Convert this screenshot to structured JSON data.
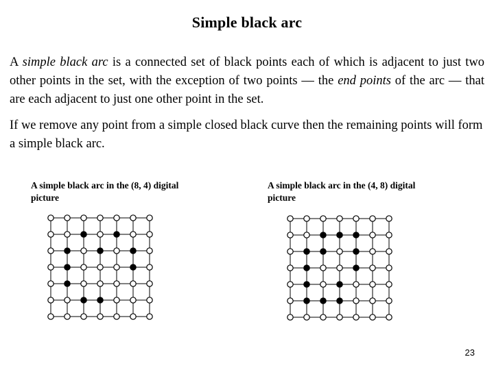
{
  "slide": {
    "title": "Simple black arc",
    "page_number": "23",
    "background_color": "#ffffff",
    "text_color": "#000000"
  },
  "body": {
    "paragraph1": {
      "segment_1": "A ",
      "emphasis_1": "simple black arc",
      "segment_2": " is a connected set of black points each of which is adjacent to just two other points in the set, with the exception of two points — the ",
      "emphasis_2": "end points",
      "segment_3": " of the arc — that are each adjacent to just one other point in the set."
    },
    "paragraph2": "If we remove any point from a simple closed black curve then the remaining points will form a simple black arc."
  },
  "figures": [
    {
      "caption": "A simple black arc in the (8, 4) digital picture",
      "adjacency": "(8, 4)",
      "grid": {
        "rows": 7,
        "cols": 7,
        "spacing": 24,
        "node_radius": 4.2,
        "black_nodes": [
          [
            1,
            2
          ],
          [
            1,
            4
          ],
          [
            2,
            1
          ],
          [
            2,
            3
          ],
          [
            2,
            5
          ],
          [
            3,
            1
          ],
          [
            3,
            5
          ],
          [
            4,
            1
          ],
          [
            5,
            2
          ],
          [
            5,
            3
          ]
        ]
      }
    },
    {
      "caption": "A simple black arc in the (4, 8) digital picture",
      "adjacency": "(4, 8)",
      "grid": {
        "rows": 7,
        "cols": 7,
        "spacing": 24,
        "node_radius": 4.2,
        "black_nodes": [
          [
            1,
            2
          ],
          [
            1,
            3
          ],
          [
            1,
            4
          ],
          [
            2,
            1
          ],
          [
            2,
            2
          ],
          [
            2,
            4
          ],
          [
            3,
            1
          ],
          [
            3,
            4
          ],
          [
            4,
            1
          ],
          [
            4,
            3
          ],
          [
            5,
            1
          ],
          [
            5,
            2
          ],
          [
            5,
            3
          ]
        ]
      }
    }
  ]
}
